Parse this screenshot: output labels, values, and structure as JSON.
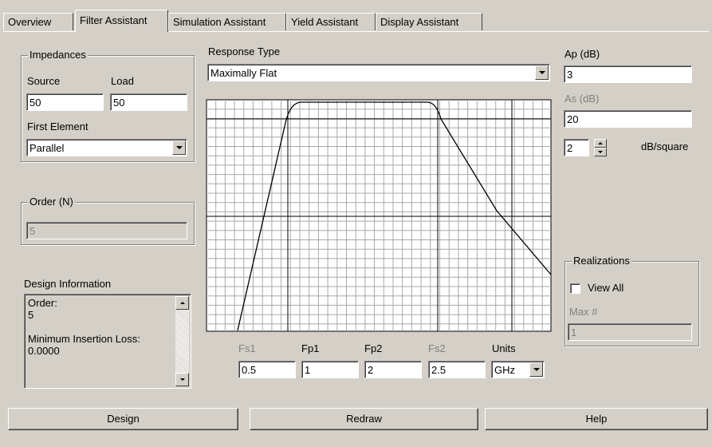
{
  "tabs": [
    {
      "label": "Overview",
      "active": false
    },
    {
      "label": "Filter Assistant",
      "active": true
    },
    {
      "label": "Simulation Assistant",
      "active": false
    },
    {
      "label": "Yield Assistant",
      "active": false
    },
    {
      "label": "Display Assistant",
      "active": false
    }
  ],
  "impedances": {
    "title": "Impedances",
    "source_label": "Source",
    "load_label": "Load",
    "source_value": "50",
    "load_value": "50",
    "first_element_label": "First Element",
    "first_element_value": "Parallel"
  },
  "order": {
    "title": "Order (N)",
    "value": "5"
  },
  "design_information": {
    "title": "Design Information",
    "lines": [
      "Order:",
      "5",
      "",
      "Minimum Insertion Loss:",
      "0.0000"
    ]
  },
  "response": {
    "label": "Response Type",
    "value": "Maximally Flat"
  },
  "frequencies": {
    "fs1_label": "Fs1",
    "fs1_value": "0.5",
    "fp1_label": "Fp1",
    "fp1_value": "1",
    "fp2_label": "Fp2",
    "fp2_value": "2",
    "fs2_label": "Fs2",
    "fs2_value": "2.5",
    "units_label": "Units",
    "units_value": "GHz"
  },
  "attenuation": {
    "ap_label": "Ap (dB)",
    "ap_value": "3",
    "as_label": "As (dB)",
    "as_value": "20",
    "slope_value": "2",
    "slope_unit": "dB/square"
  },
  "realizations": {
    "title": "Realizations",
    "view_all_label": "View All",
    "view_all_checked": false,
    "max_label": "Max #",
    "max_value": "1"
  },
  "buttons": {
    "design": "Design",
    "redraw": "Redraw",
    "help": "Help"
  },
  "icons": [
    "chevron-down-icon",
    "scroll-up-icon",
    "scroll-down-icon",
    "spin-up-icon",
    "spin-down-icon"
  ],
  "colors": {
    "face": "#d4d0c8",
    "field": "#ffffff",
    "disabled_text": "#808080",
    "plot_grid": "#a0a0a0",
    "plot_line": "#000000"
  }
}
